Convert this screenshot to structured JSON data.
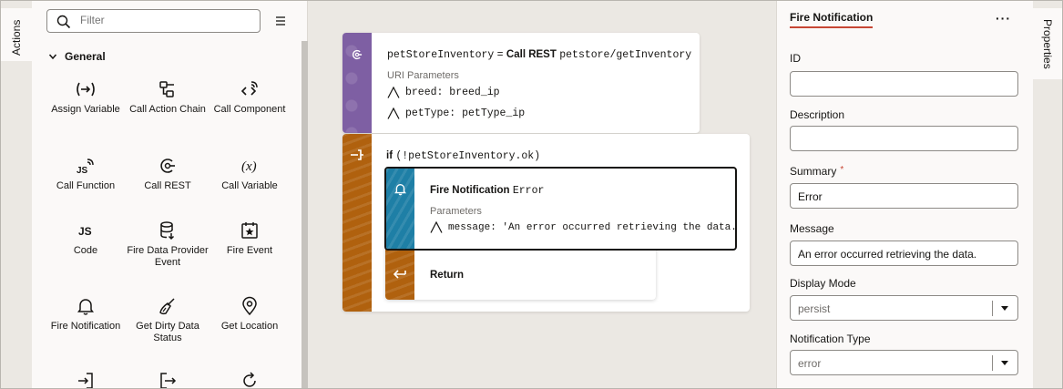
{
  "left_tabs": {
    "actions": "Actions"
  },
  "palette": {
    "filter_placeholder": "Filter",
    "group": "General",
    "items": [
      {
        "label": "Assign Variable",
        "icon": "assign-variable-icon"
      },
      {
        "label": "Call Action Chain",
        "icon": "call-action-chain-icon"
      },
      {
        "label": "Call Component",
        "icon": "call-component-icon"
      },
      {
        "label": "Call Function",
        "icon": "call-function-icon"
      },
      {
        "label": "Call REST",
        "icon": "call-rest-icon"
      },
      {
        "label": "Call Variable",
        "icon": "call-variable-icon"
      },
      {
        "label": "Code",
        "icon": "code-icon"
      },
      {
        "label": "Fire Data Provider Event",
        "icon": "fire-data-provider-event-icon"
      },
      {
        "label": "Fire Event",
        "icon": "fire-event-icon"
      },
      {
        "label": "Fire Notification",
        "icon": "bell-icon"
      },
      {
        "label": "Get Dirty Data Status",
        "icon": "broom-icon"
      },
      {
        "label": "Get Location",
        "icon": "location-pin-icon"
      }
    ]
  },
  "canvas": {
    "rest_card": {
      "variable": "petStoreInventory",
      "equals": "=",
      "action": "Call REST",
      "endpoint": "petstore/getInventory",
      "params_title": "URI Parameters",
      "params": [
        {
          "text": "breed: breed_ip"
        },
        {
          "text": "petType: petType_ip"
        }
      ]
    },
    "if_card": {
      "keyword": "if",
      "condition": "(!petStoreInventory.ok)"
    },
    "notification_card": {
      "title": "Fire Notification",
      "summary": "Error",
      "params_title": "Parameters",
      "param": "message: 'An error occurred retrieving the data.'"
    },
    "return_card": {
      "label": "Return"
    }
  },
  "properties": {
    "title": "Fire Notification",
    "more": "···",
    "fields": {
      "id_label": "ID",
      "id_value": "",
      "description_label": "Description",
      "description_value": "",
      "summary_label": "Summary",
      "summary_required": "*",
      "summary_value": "Error",
      "message_label": "Message",
      "message_value": "An error occurred retrieving the data.",
      "display_mode_label": "Display Mode",
      "display_mode_value": "persist",
      "notification_type_label": "Notification Type",
      "notification_type_value": "error"
    }
  },
  "right_tabs": {
    "properties": "Properties"
  },
  "colors": {
    "rest_band": "#7e5fa3",
    "if_band": "#b0610e",
    "notification_band": "#1e7fa6",
    "accent_underline": "#c74634"
  }
}
